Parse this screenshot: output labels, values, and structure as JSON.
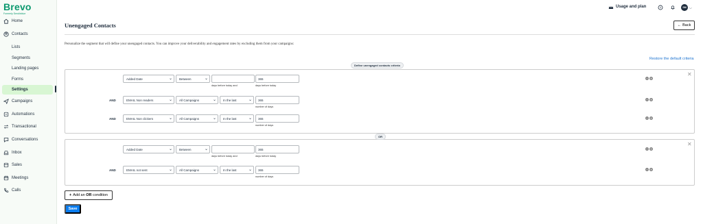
{
  "brand": {
    "name": "Brevo",
    "subtitle": "Formerly Sendinblue",
    "color": "#0b996e"
  },
  "sidebar": {
    "items": [
      {
        "label": "Home",
        "icon": "home-icon"
      },
      {
        "label": "Contacts",
        "icon": "contacts-icon"
      },
      {
        "label": "Lists"
      },
      {
        "label": "Segments"
      },
      {
        "label": "Landing pages"
      },
      {
        "label": "Forms"
      },
      {
        "label": "Settings",
        "active": true
      },
      {
        "label": "Campaigns",
        "icon": "send-icon"
      },
      {
        "label": "Automations",
        "icon": "automation-icon"
      },
      {
        "label": "Transactional",
        "icon": "transfer-icon"
      },
      {
        "label": "Conversations",
        "icon": "chat-icon"
      },
      {
        "label": "Inbox",
        "icon": "inbox-icon"
      },
      {
        "label": "Sales",
        "icon": "sales-icon"
      },
      {
        "label": "Meetings",
        "icon": "calendar-icon"
      },
      {
        "label": "Calls",
        "icon": "phone-icon"
      }
    ]
  },
  "topbar": {
    "usage_label": "Usage and plan",
    "avatar_initials": "SM"
  },
  "page": {
    "title": "Unengaged Contacts",
    "back_label": "Back",
    "description": "Personalize the segment that will define your unengaged contacts. You can improve your deliverability and engagement rates by excluding them from your campaigns:",
    "restore_label": "Restore the default criteria",
    "criteria_pill": "Define unengaged contacts criteria",
    "or_pill": "OR",
    "add_or_prefix": "Add an ",
    "add_or_bold": "OR",
    "add_or_suffix": " condition",
    "save_label": "Save"
  },
  "groups": [
    {
      "rows": [
        {
          "prefix": "",
          "field": "Added Date",
          "operator": "Between",
          "scope": "",
          "period": "",
          "value_a": "",
          "value_b": "365",
          "hint_a": "days before today and",
          "hint_b": "days before today"
        },
        {
          "prefix": "AND",
          "field": "EMAIL Non readers",
          "operator": "",
          "scope": "All Campaigns",
          "period": "In the last",
          "value_a": "",
          "value_b": "365",
          "hint_a": "",
          "hint_b": "number of days"
        },
        {
          "prefix": "AND",
          "field": "EMAIL Non clickers",
          "operator": "",
          "scope": "All Campaigns",
          "period": "In the last",
          "value_a": "",
          "value_b": "365",
          "hint_a": "",
          "hint_b": "number of days"
        }
      ]
    },
    {
      "rows": [
        {
          "prefix": "",
          "field": "Added Date",
          "operator": "Between",
          "scope": "",
          "period": "",
          "value_a": "",
          "value_b": "365",
          "hint_a": "days before today and",
          "hint_b": "days before today"
        },
        {
          "prefix": "AND",
          "field": "EMAIL not sent",
          "operator": "",
          "scope": "All Campaigns",
          "period": "In the last",
          "value_a": "",
          "value_b": "365",
          "hint_a": "",
          "hint_b": "number of days"
        }
      ]
    }
  ],
  "colors": {
    "accent": "#0b7ef0",
    "active_bg": "#d8f6d3",
    "link": "#1f74d0"
  }
}
